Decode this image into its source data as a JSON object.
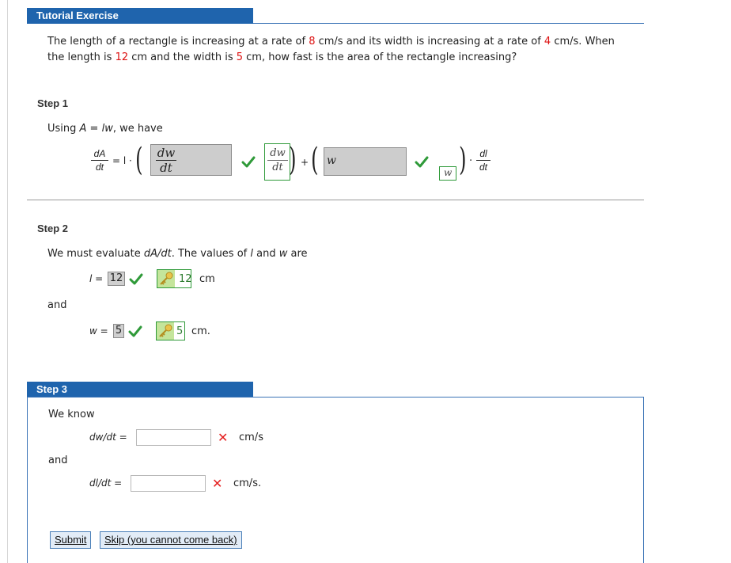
{
  "header": {
    "title": "Tutorial Exercise"
  },
  "problem": {
    "p1": "The length of a rectangle is increasing at a rate of ",
    "rate_length": "8",
    "p2": " cm/s and its width is increasing at a rate of ",
    "rate_width": "4",
    "p3": " cm/s. When",
    "p4": "the length is ",
    "length": "12",
    "p5": " cm and the width is ",
    "width": "5",
    "p6": " cm, how fast is the area of the rectangle increasing?"
  },
  "step1": {
    "label": "Step 1",
    "intro_using": "Using ",
    "intro_formula": "A = lw",
    "intro_rest": ", we have",
    "lhs_num": "dA",
    "lhs_den": "dt",
    "eq_l": "= l ·",
    "answer1_num": "dw",
    "answer1_den": "dt",
    "correct1_num": "dw",
    "correct1_den": "dt",
    "plus": "+",
    "answer2": "w",
    "correct2": "w",
    "rhs_num": "dl",
    "rhs_den": "dt",
    "dot": "·"
  },
  "step2": {
    "label": "Step 2",
    "intro": "We must evaluate ",
    "intro_expr": "dA/dt",
    "intro_mid": ". The values of ",
    "intro_l": "l",
    "intro_and": " and ",
    "intro_w": "w",
    "intro_end": " are",
    "l_var": "l",
    "l_eq": " = ",
    "l_answer": "12",
    "l_correct": "12",
    "l_unit": "cm",
    "and": "and",
    "w_var": "w",
    "w_eq": " = ",
    "w_answer": "5",
    "w_correct": "5",
    "w_unit": "cm."
  },
  "step3": {
    "label": "Step 3",
    "intro": "We know",
    "dwdt_label": "dw/dt",
    "eq": " =",
    "dwdt_value": "",
    "unit1": "cm/s",
    "and": "and",
    "dldt_label": "dl/dt",
    "dldt_value": "",
    "unit2": "cm/s."
  },
  "buttons": {
    "submit": "Submit",
    "skip": "Skip (you cannot come back)"
  },
  "colors": {
    "header_bg": "#1f64ad",
    "correct_green": "#2f9a39",
    "wrong_red": "#e52020",
    "highlight_red": "#dd1111"
  }
}
